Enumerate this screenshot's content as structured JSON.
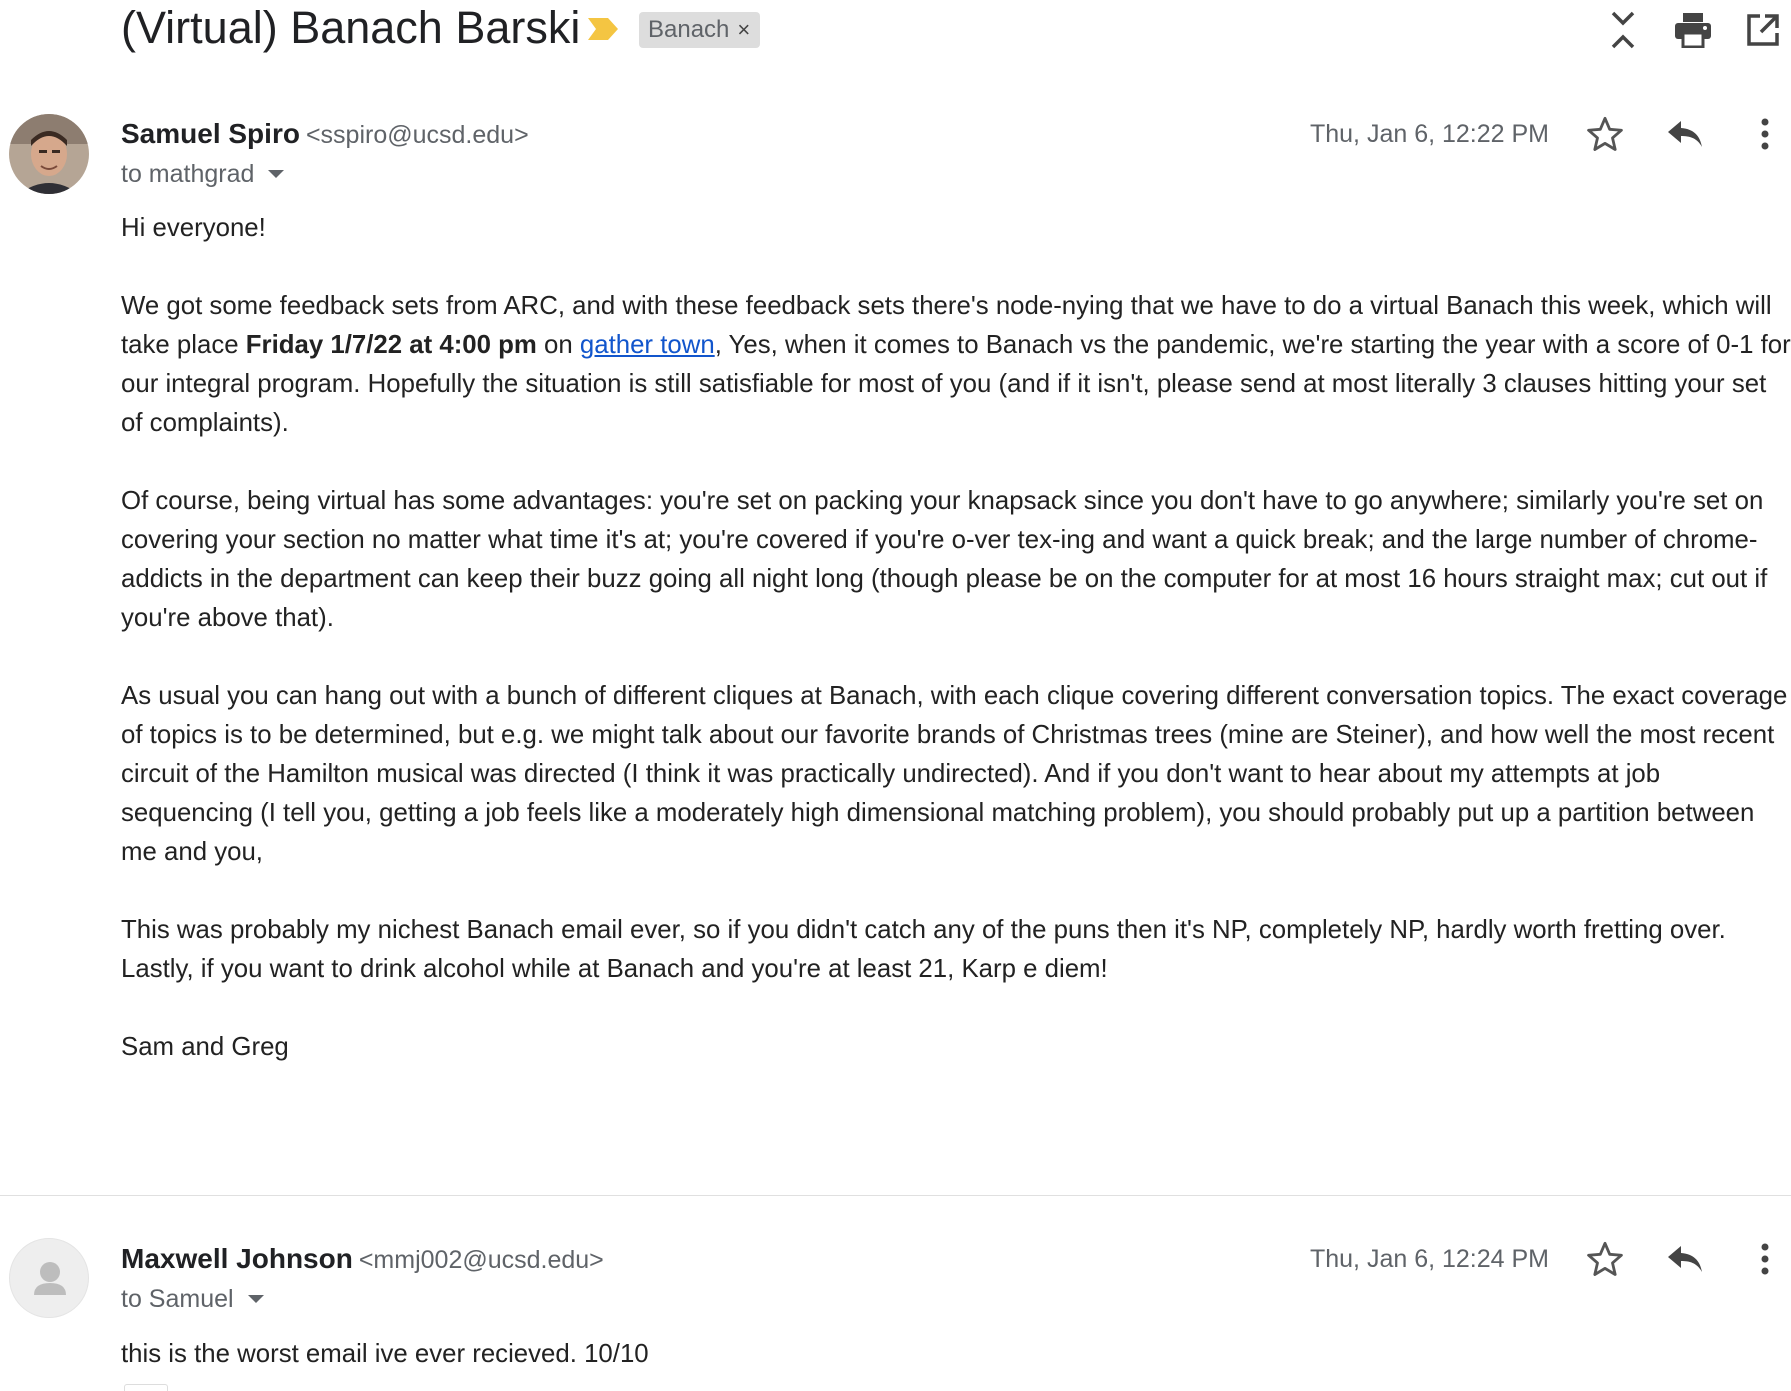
{
  "thread": {
    "subject": "(Virtual) Banach Barski",
    "label": "Banach",
    "label_remove": "×",
    "icons": [
      "collapse-all-icon",
      "print-icon",
      "open-new-window-icon"
    ],
    "importance_color": "#f4c542"
  },
  "messages": [
    {
      "sender_name": "Samuel Spiro",
      "sender_email": "<sspiro@ucsd.edu>",
      "to": "to mathgrad",
      "date": "Thu, Jan 6, 12:22 PM",
      "greeting": "Hi everyone!",
      "p1_a": "We got some feedback sets from ARC, and with these feedback sets there's node-nying that we have to do a virtual Banach this week, which will take place ",
      "p1_bold": "Friday 1/7/22 at 4:00 pm",
      "p1_b": " on ",
      "p1_link": "gather town",
      "p1_c": ",  Yes, when it comes to Banach vs the pandemic, we're starting the year with a score of  0-1 for our integral program.  Hopefully the situation is still satisfiable for most of you (and if it isn't, please send at most literally 3 clauses hitting your set of complaints).",
      "p2": "Of course, being virtual has some advantages: you're set on packing your knapsack since you don't have to go anywhere; similarly you're set on covering your section no matter what time it's at; you're covered if you're o-ver tex-ing and want a quick break; and the large number of chrome-addicts in the department can keep their buzz going all night long (though please be on the computer for at most 16 hours straight max; cut out if you're above that).",
      "p3": "As usual you can hang out with a bunch of different cliques at Banach, with each clique covering different conversation topics.  The exact coverage of topics is to be determined, but e.g. we might talk about our favorite brands of Christmas trees (mine are Steiner), and how well the most recent circuit of the Hamilton musical was directed (I think it was practically undirected).  And if you don't want to hear about my attempts at job sequencing (I tell you, getting a job feels like a moderately high dimensional matching problem), you should probably put up a partition between me and you,",
      "p4": "This was probably my nichest Banach email ever, so if you didn't catch any of the puns then it's NP, completely NP, hardly worth fretting over.  Lastly, if you want to drink alcohol while at Banach and you're at least 21, Karp e diem!",
      "signature": "Sam and Greg"
    },
    {
      "sender_name": "Maxwell Johnson",
      "sender_email": "<mmj002@ucsd.edu>",
      "to": "to Samuel",
      "date": "Thu, Jan 6, 12:24 PM",
      "body": "this is the worst email ive ever recieved. 10/10"
    }
  ]
}
